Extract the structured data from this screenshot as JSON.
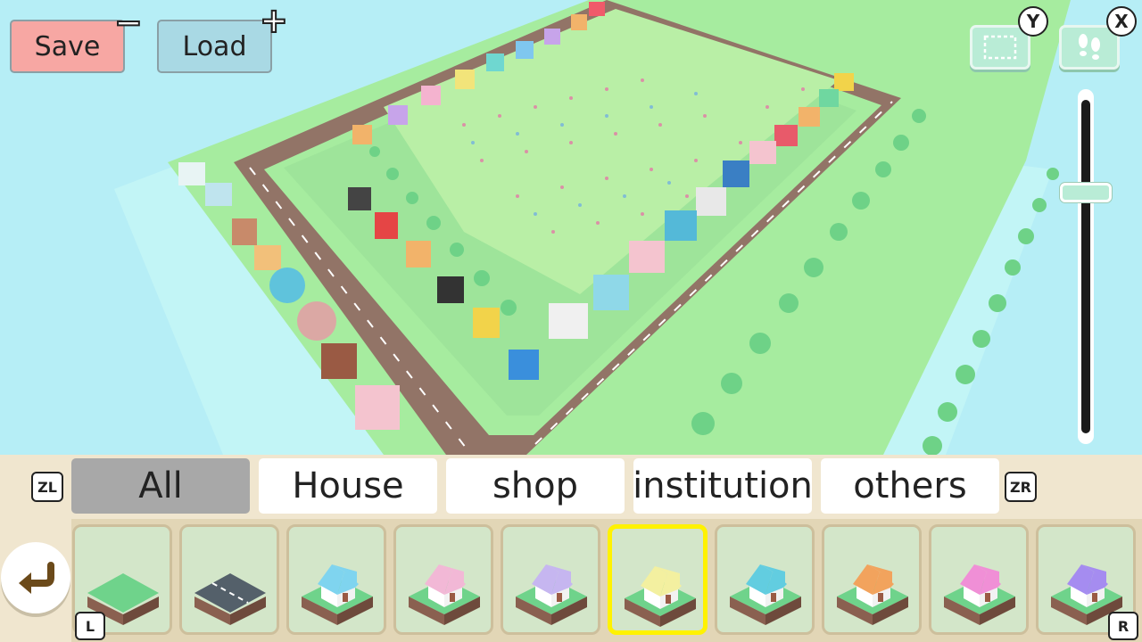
{
  "toolbar": {
    "save_label": "Save",
    "load_label": "Load",
    "save_hint": "−",
    "load_hint": "+",
    "select_tool_hint": "Y",
    "walk_tool_hint": "X"
  },
  "zoom": {
    "level": 0.72
  },
  "categories": {
    "prev_hint": "ZL",
    "next_hint": "ZR",
    "tabs": [
      {
        "label": "All",
        "active": true
      },
      {
        "label": "House",
        "active": false
      },
      {
        "label": "shop",
        "active": false
      },
      {
        "label": "institution",
        "active": false
      },
      {
        "label": "others",
        "active": false
      }
    ]
  },
  "palette": {
    "prev_hint": "L",
    "next_hint": "R",
    "selected_index": 5,
    "items": [
      {
        "type": "grass-tile",
        "roof": "#6fd38b"
      },
      {
        "type": "road-tile",
        "roof": "#54606a"
      },
      {
        "type": "house",
        "roof": "#7fd4ef"
      },
      {
        "type": "house",
        "roof": "#f2b8d6"
      },
      {
        "type": "house",
        "roof": "#c6b6f0"
      },
      {
        "type": "house",
        "roof": "#f3f0a0"
      },
      {
        "type": "house",
        "roof": "#62cde0"
      },
      {
        "type": "house",
        "roof": "#f2a35d"
      },
      {
        "type": "house",
        "roof": "#f08fd6"
      },
      {
        "type": "house",
        "roof": "#a58cf0"
      }
    ]
  },
  "colors": {
    "water": "#b6eef6",
    "grass": "#9de89a",
    "road": "#8f6f62",
    "trees": "#6ed287",
    "selected_border": "#fff200"
  }
}
